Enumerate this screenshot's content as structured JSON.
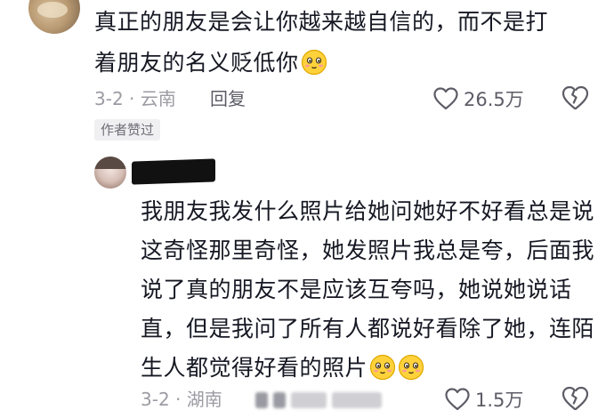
{
  "comment": {
    "text_line1": "真正的朋友是会让你越来越自信的，而不是打",
    "text_line2": "着朋友的名义贬低你",
    "emoji": "blush-smile-emoji",
    "meta": "3-2 · 云南",
    "reply_label": "回复",
    "like_count": "26.5万",
    "author_badge": "作者赞过"
  },
  "reply": {
    "text": "我朋友我发什么照片给她问她好不好看总是说这奇怪那里奇怪，她发照片我总是夸，后面我说了真的朋友不是应该互夸吗，她说她说话直，但是我问了所有人都说好看除了她，连陌生人都觉得好看的照片",
    "emojis": [
      "blush-smile-emoji",
      "blush-smile-emoji"
    ],
    "meta": "3-2 · 湖南",
    "like_count": "1.5万"
  },
  "colors": {
    "text": "#161823",
    "meta": "#9b9ba3",
    "badge_bg": "#f0f0f2",
    "emoji_face": "#ffd23c"
  },
  "icons": [
    "heart-outline-icon",
    "broken-heart-icon"
  ]
}
